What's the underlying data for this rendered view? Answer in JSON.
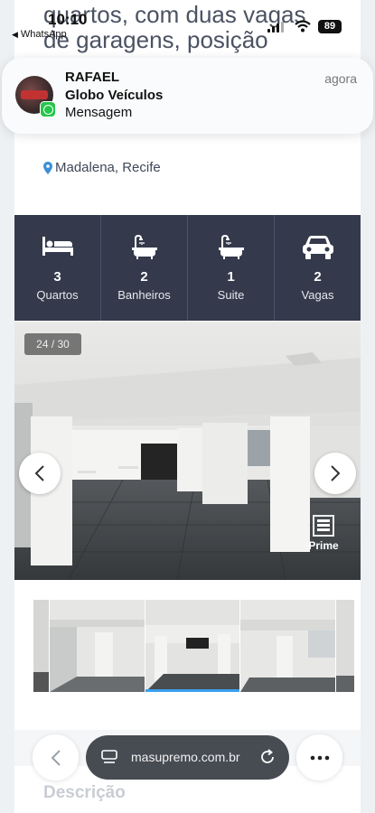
{
  "status_bar": {
    "time": "10:10",
    "back_app": "WhatsApp",
    "battery": "89"
  },
  "listing": {
    "heading_line1": "quartos, com duas vagas",
    "heading_line2": "de garagens, posição",
    "location": "Madalena, Recife"
  },
  "notification": {
    "sender": "RAFAEL",
    "title": "Globo Veículos",
    "body": "Mensagem",
    "time": "agora"
  },
  "features": [
    {
      "icon": "bed-icon",
      "value": "3",
      "label": "Quartos"
    },
    {
      "icon": "bathtub-icon",
      "value": "2",
      "label": "Banheiros"
    },
    {
      "icon": "bathtub-icon",
      "value": "1",
      "label": "Suite"
    },
    {
      "icon": "car-icon",
      "value": "2",
      "label": "Vagas"
    }
  ],
  "gallery": {
    "counter": "24 / 30",
    "watermark": "Prime"
  },
  "thumbnails": {
    "active_index": 1,
    "count_visible": 4
  },
  "section": {
    "description_title": "Descrição"
  },
  "browser": {
    "url": "masupremo.com.br"
  }
}
